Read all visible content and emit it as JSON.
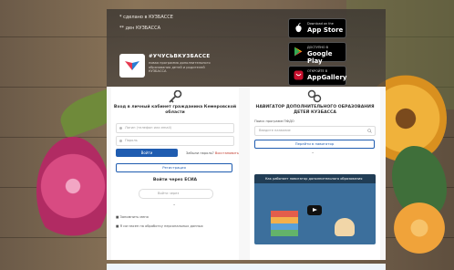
{
  "header": {
    "line1": "* сделано в КУЗБАССЕ",
    "line2": "** ден КУЗБАССА",
    "brand_name": "#УЧУСЬВКУЗБАССЕ",
    "brand_sub": "новая программа дополнительного образования детей и родителей КУЗБАССА",
    "stores": [
      {
        "pre": "Download on the",
        "name": "App Store"
      },
      {
        "pre": "ДОСТУПНО В",
        "name": "Google Play"
      },
      {
        "pre": "ОТКРОЙТЕ В",
        "name": "AppGallery"
      }
    ]
  },
  "login": {
    "title": "Вход в личный кабинет гражданина Кемеровской области",
    "login_placeholder": "Логин (телефон или email)",
    "password_placeholder": "Пароль",
    "submit": "Войти",
    "forgot_prefix": "Забыли пароль?",
    "forgot_link": "Восстановить",
    "register": "Регистрация",
    "esia_title": "Войти через ЕСИА",
    "esia_field": "Войти через",
    "check1": "Запомнить меня",
    "check2": "Я согласен на обработку персональных данных"
  },
  "navigator": {
    "title": "НАВИГАТОР ДОПОЛНИТЕЛЬНОГО ОБРАЗОВАНИЯ ДЕТЕЙ КУЗБАССА",
    "search_label": "Поиск программ ПФДО",
    "search_placeholder": "Введите название",
    "button": "Перейти в навигатор",
    "video_title": "Как работает навигатор дополнительного образования"
  },
  "colors": {
    "primary": "#1f5cb0",
    "header_bg": "#3c3732",
    "link": "#c0392b"
  }
}
